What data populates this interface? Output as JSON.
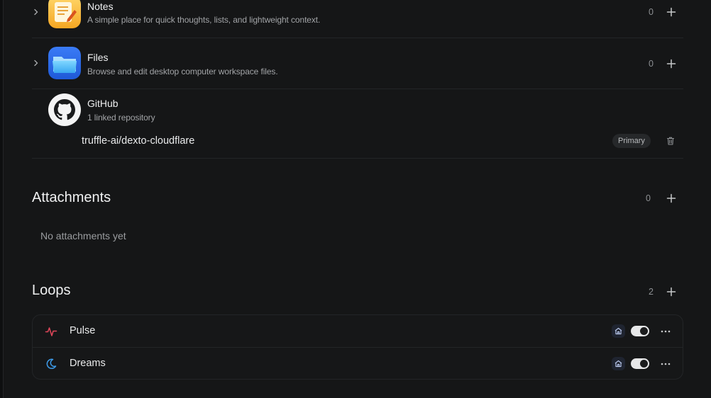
{
  "integrations": [
    {
      "title": "Notes",
      "subtitle": "A simple place for quick thoughts, lists, and lightweight context.",
      "count": "0",
      "icon": "notes-app-icon"
    },
    {
      "title": "Files",
      "subtitle": "Browse and edit desktop computer workspace files.",
      "count": "0",
      "icon": "files-app-icon"
    },
    {
      "title": "GitHub",
      "subtitle": "1 linked repository",
      "icon": "github-icon",
      "repository": "truffle-ai/dexto-cloudflare",
      "repository_badge": "Primary"
    }
  ],
  "attachments": {
    "title": "Attachments",
    "count": "0",
    "empty_text": "No attachments yet"
  },
  "loops": {
    "title": "Loops",
    "count": "2",
    "items": [
      {
        "name": "Pulse",
        "icon": "pulse-icon",
        "enabled": true,
        "icon_color": "#e0475a"
      },
      {
        "name": "Dreams",
        "icon": "moon-icon",
        "enabled": true,
        "icon_color": "#3d9be9"
      }
    ]
  },
  "colors": {
    "background": "#151617",
    "divider": "#232527",
    "text_primary": "#e9eaeb",
    "text_secondary": "#a2a4a7"
  }
}
